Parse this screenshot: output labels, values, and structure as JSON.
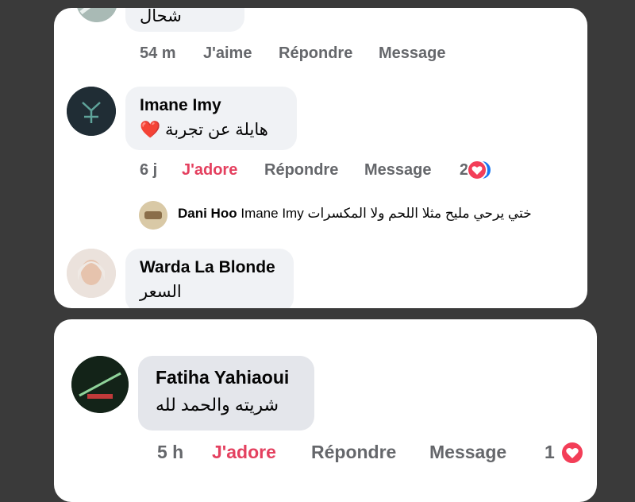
{
  "comments": [
    {
      "partial_text": "شحال",
      "time": "54 m",
      "like_label": "J'aime",
      "reply_label": "Répondre",
      "message_label": "Message"
    },
    {
      "author": "Imane Imy",
      "text": "هايلة عن تجربة",
      "time": "6 j",
      "like_label": "J'adore",
      "reply_label": "Répondre",
      "message_label": "Message",
      "reaction_count": "2",
      "reply": {
        "author": "Dani Hoo",
        "mention": "Imane Imy",
        "text": "ختي يرحي مليح مثلا اللحم ولا المكسرات"
      }
    },
    {
      "author": "Warda La Blonde",
      "text": "السعر"
    },
    {
      "author": "Fatiha Yahiaoui",
      "text": "شريته والحمد لله",
      "time": "5 h",
      "like_label": "J'adore",
      "reply_label": "Répondre",
      "message_label": "Message",
      "reaction_count": "1"
    }
  ],
  "colors": {
    "love": "#e4405f",
    "like": "#1877f2",
    "meta": "#65676b"
  }
}
